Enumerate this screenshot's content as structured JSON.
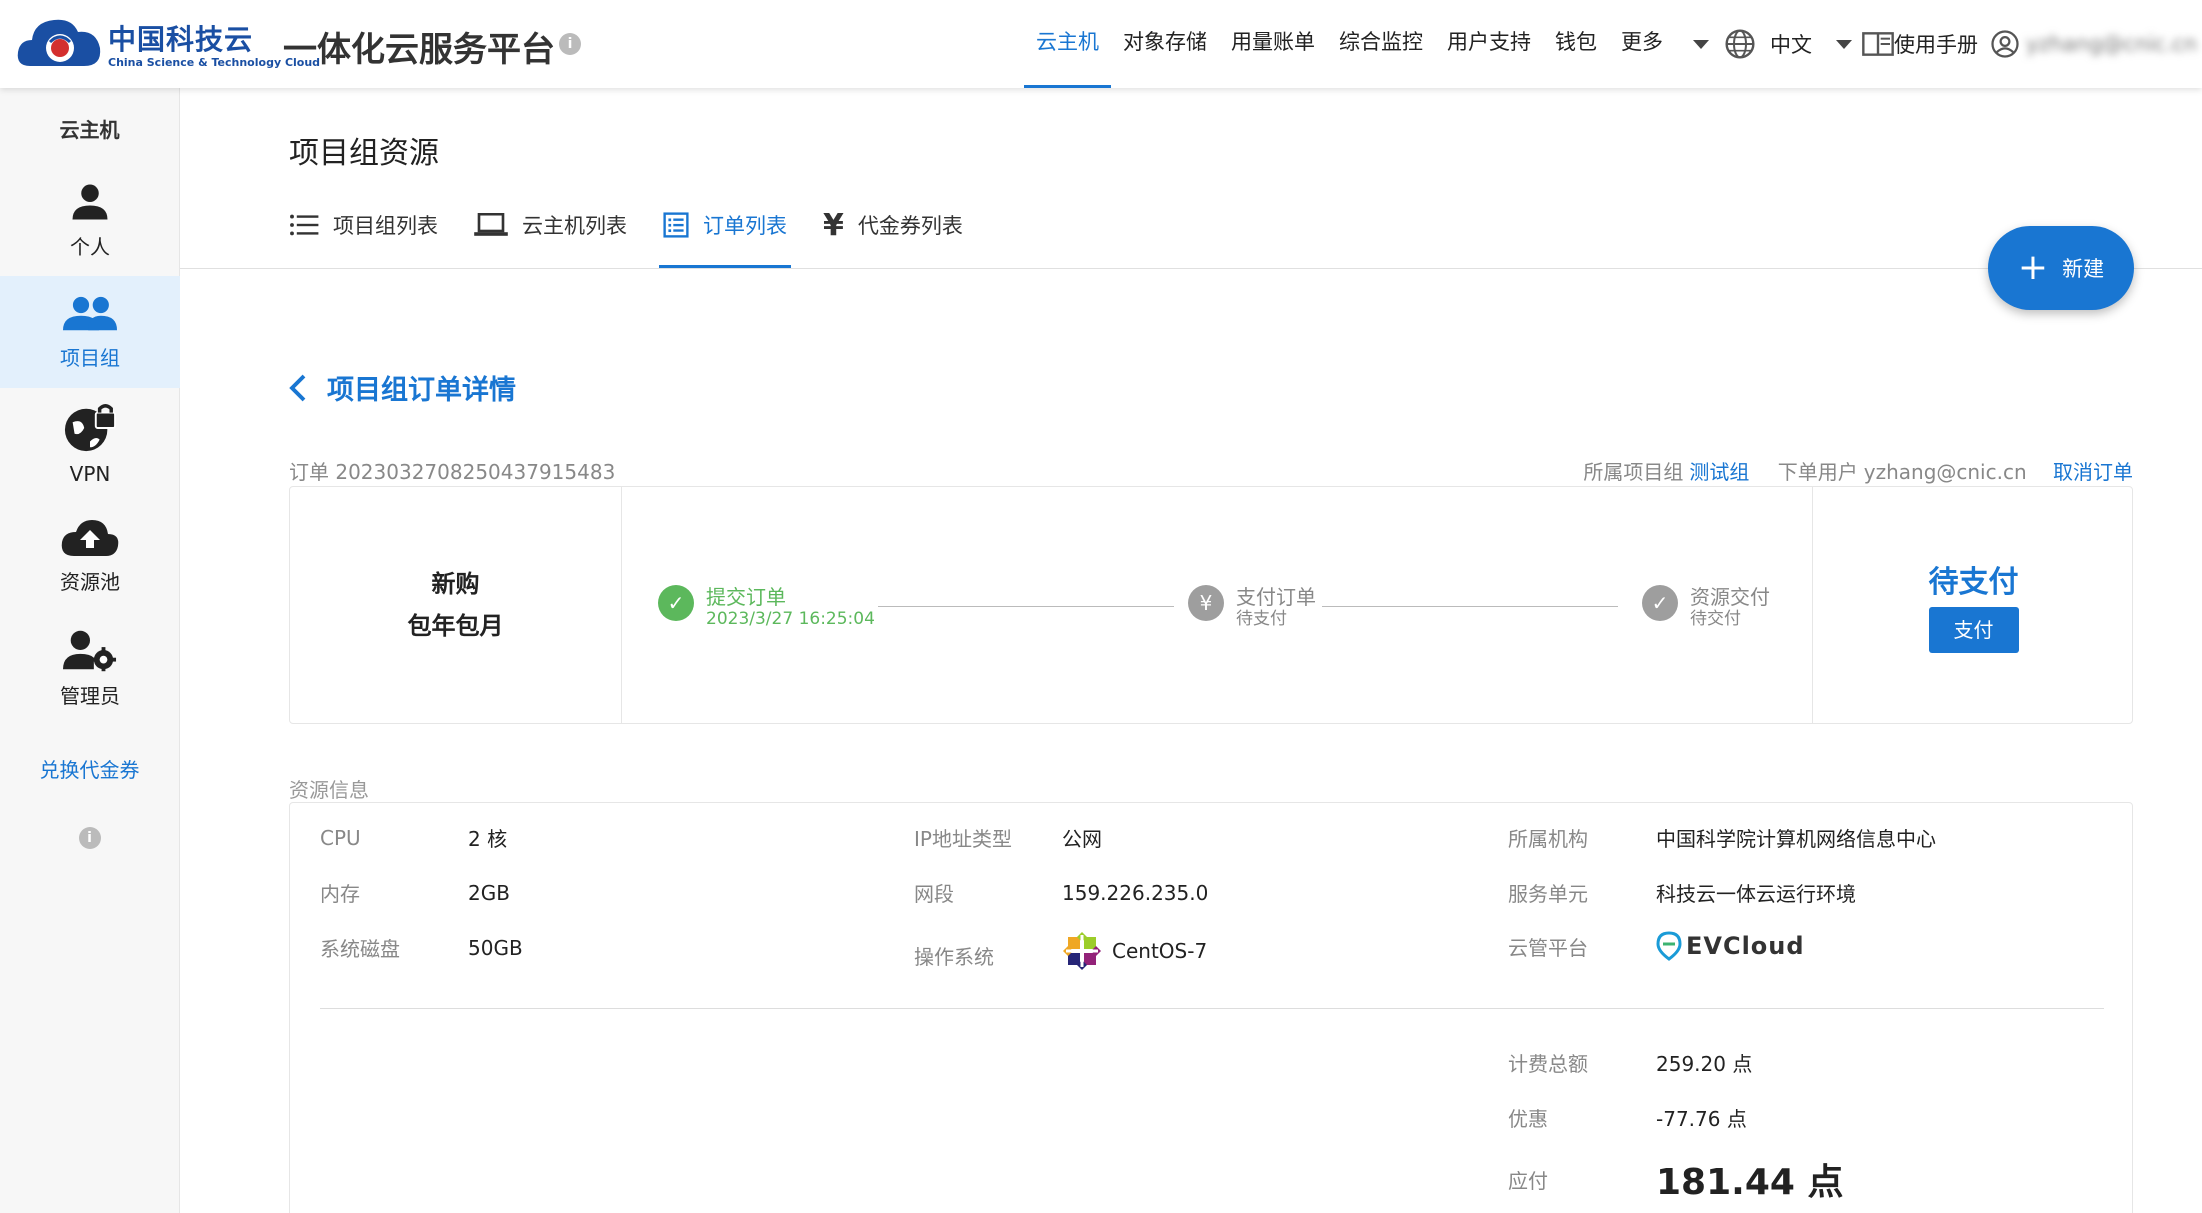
{
  "header": {
    "logo_cn": "中国科技云",
    "logo_en": "China Science & Technology Cloud",
    "platform_title": "一体化云服务平台",
    "nav": [
      {
        "label": "云主机",
        "active": true
      },
      {
        "label": "对象存储",
        "active": false
      },
      {
        "label": "用量账单",
        "active": false
      },
      {
        "label": "综合监控",
        "active": false
      },
      {
        "label": "用户支持",
        "active": false
      },
      {
        "label": "钱包",
        "active": false
      },
      {
        "label": "更多",
        "active": false
      }
    ],
    "language": "中文",
    "manual": "使用手册",
    "user": "yzhang@cnic.cn"
  },
  "sidebar": {
    "heading": "云主机",
    "items": [
      {
        "label": "个人",
        "icon": "person-icon",
        "active": false
      },
      {
        "label": "项目组",
        "icon": "group-icon",
        "active": true
      },
      {
        "label": "VPN",
        "icon": "vpn-icon",
        "active": false
      },
      {
        "label": "资源池",
        "icon": "cloud-upload-icon",
        "active": false
      },
      {
        "label": "管理员",
        "icon": "admin-icon",
        "active": false
      }
    ],
    "redeem": "兑换代金券"
  },
  "main": {
    "page_title": "项目组资源",
    "tabs": [
      {
        "label": "项目组列表",
        "icon": "list-icon",
        "active": false
      },
      {
        "label": "云主机列表",
        "icon": "laptop-icon",
        "active": false
      },
      {
        "label": "订单列表",
        "icon": "order-list-icon",
        "active": true
      },
      {
        "label": "代金券列表",
        "icon": "yen-icon",
        "active": false
      }
    ],
    "new_button": "新建",
    "back_title": "项目组订单详情"
  },
  "order": {
    "id_label": "订单",
    "id": "2023032708250437915483",
    "group_label": "所属项目组",
    "group": "测试组",
    "user_label": "下单用户",
    "user": "yzhang@cnic.cn",
    "cancel": "取消订单",
    "type_line1": "新购",
    "type_line2": "包年包月",
    "steps": [
      {
        "title": "提交订单",
        "sub": "2023/3/27 16:25:04",
        "state": "done"
      },
      {
        "title": "支付订单",
        "sub": "待支付",
        "state": "pending"
      },
      {
        "title": "资源交付",
        "sub": "待交付",
        "state": "pending"
      }
    ],
    "status": "待支付",
    "pay_button": "支付"
  },
  "resource": {
    "section_label": "资源信息",
    "col1": [
      {
        "k": "CPU",
        "v": "2 核"
      },
      {
        "k": "内存",
        "v": "2GB"
      },
      {
        "k": "系统磁盘",
        "v": "50GB"
      }
    ],
    "col2": [
      {
        "k": "IP地址类型",
        "v": "公网"
      },
      {
        "k": "网段",
        "v": "159.226.235.0"
      },
      {
        "k": "操作系统",
        "v": "CentOS-7"
      }
    ],
    "col3": [
      {
        "k": "所属机构",
        "v": "中国科学院计算机网络信息中心"
      },
      {
        "k": "服务单元",
        "v": "科技云一体云运行环境"
      },
      {
        "k": "云管平台",
        "v": "EVCloud"
      }
    ],
    "billing": [
      {
        "k": "计费总额",
        "v": "259.20 点"
      },
      {
        "k": "优惠",
        "v": "-77.76 点"
      },
      {
        "k": "应付",
        "v": "181.44 点"
      }
    ]
  },
  "colors": {
    "accent": "#1976d2",
    "success": "#5cb85c",
    "pending": "#9e9e9e"
  }
}
